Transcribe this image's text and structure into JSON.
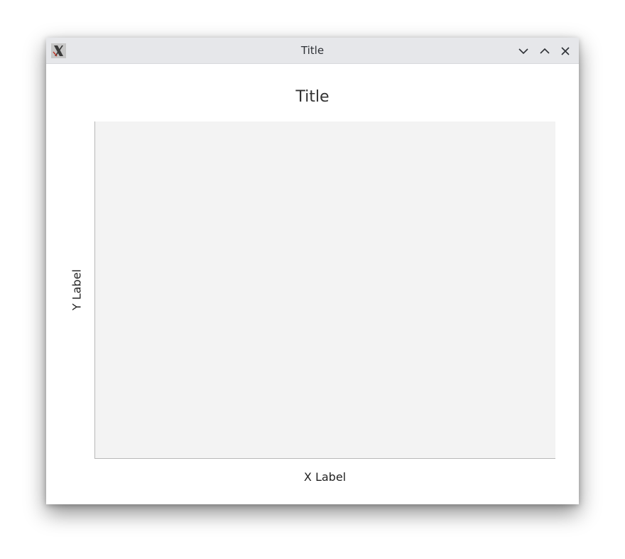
{
  "window": {
    "title": "Title",
    "icon": "x11-app-icon",
    "controls": {
      "minimize": "chevron-down-icon",
      "maximize": "chevron-up-icon",
      "close": "close-icon"
    }
  },
  "chart": {
    "title": "Title",
    "xlabel": "X Label",
    "ylabel": "Y Label"
  },
  "chart_data": {
    "type": "line",
    "title": "Title",
    "xlabel": "X Label",
    "ylabel": "Y Label",
    "series": [],
    "grid": false
  }
}
